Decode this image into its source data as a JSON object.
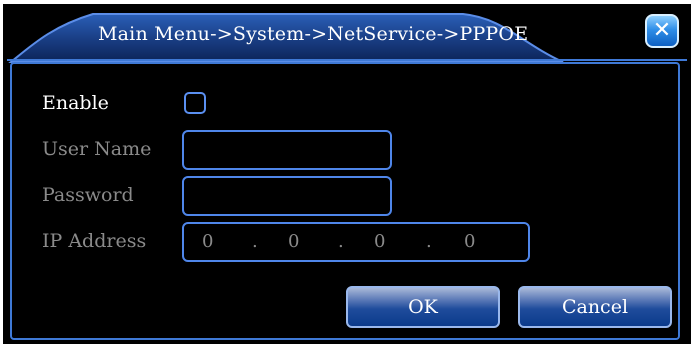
{
  "window": {
    "title": "Main Menu->System->NetService->PPPOE",
    "close_glyph": "✕",
    "close_icon": "close-icon"
  },
  "form": {
    "enable_label": "Enable",
    "enable_checked": false,
    "username_label": "User Name",
    "username_value": "",
    "password_label": "Password",
    "password_value": "",
    "ip_label": "IP Address",
    "ip_octets": [
      "0",
      "0",
      "0",
      "0"
    ],
    "ip_separator": "."
  },
  "buttons": {
    "ok_label": "OK",
    "cancel_label": "Cancel"
  },
  "colors": {
    "accent": "#3f79d6",
    "background": "#000000",
    "text": "#ffffff",
    "disabled_text": "#8a8a8a"
  }
}
